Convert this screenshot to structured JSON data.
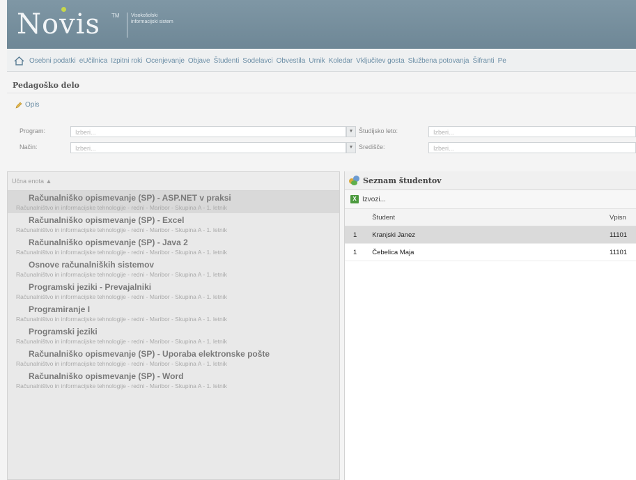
{
  "header": {
    "logo": "Novis",
    "tm": "TM",
    "subtitle": "Visokošolski informacijski sistem"
  },
  "menu": {
    "items": [
      "Osebni podatki",
      "eUčilnica",
      "Izpitni roki",
      "Ocenjevanje",
      "Objave",
      "Študenti",
      "Sodelavci",
      "Obvestila",
      "Urnik",
      "Koledar",
      "Vključitev gosta",
      "Službena potovanja",
      "Šifranti",
      "Pe"
    ]
  },
  "page": {
    "title": "Pedagoško delo",
    "opis": "Opis"
  },
  "filters": {
    "program_label": "Program:",
    "nacin_label": "Način:",
    "studijsko_leto_label": "Študijsko leto:",
    "sredisce_label": "Središče:",
    "placeholder": "Izberi..."
  },
  "left_panel": {
    "header": "Učna enota ▲",
    "courses": [
      {
        "title": "Računalniško opismevanje (SP) - ASP.NET v praksi",
        "sub": "Računalništvo in informacijske tehnologije - redni - Maribor - Skupina A - 1. letnik"
      },
      {
        "title": "Računalniško opismevanje (SP) - Excel",
        "sub": "Računalništvo in informacijske tehnologije - redni - Maribor - Skupina A - 1. letnik"
      },
      {
        "title": "Računalniško opismevanje (SP) - Java 2",
        "sub": "Računalništvo in informacijske tehnologije - redni - Maribor - Skupina A - 1. letnik"
      },
      {
        "title": "Osnove računalniških sistemov",
        "sub": "Računalništvo in informacijske tehnologije - redni - Maribor - Skupina A - 1. letnik"
      },
      {
        "title": "Programski jeziki - Prevajalniki",
        "sub": "Računalništvo in informacijske tehnologije - redni - Maribor - Skupina A - 1. letnik"
      },
      {
        "title": "Programiranje I",
        "sub": "Računalništvo in informacijske tehnologije - redni - Maribor - Skupina A - 1. letnik"
      },
      {
        "title": "Programski jeziki",
        "sub": "Računalništvo in informacijske tehnologije - redni - Maribor - Skupina A - 1. letnik"
      },
      {
        "title": "Računalniško opismevanje (SP) - Uporaba elektronske pošte",
        "sub": "Računalništvo in informacijske tehnologije - redni - Maribor - Skupina A - 1. letnik"
      },
      {
        "title": "Računalniško opismevanje (SP) - Word",
        "sub": "Računalništvo in informacijske tehnologije - redni - Maribor - Skupina A - 1. letnik"
      }
    ]
  },
  "right_panel": {
    "title": "Seznam študentov",
    "export_label": "Izvozi...",
    "columns": {
      "student": "Študent",
      "vpisna": "Vpisn"
    },
    "rows": [
      {
        "num": "1",
        "name": "Kranjski Janez",
        "vpisna": "11101"
      },
      {
        "num": "1",
        "name": "Čebelica Maja",
        "vpisna": "11101"
      }
    ]
  }
}
